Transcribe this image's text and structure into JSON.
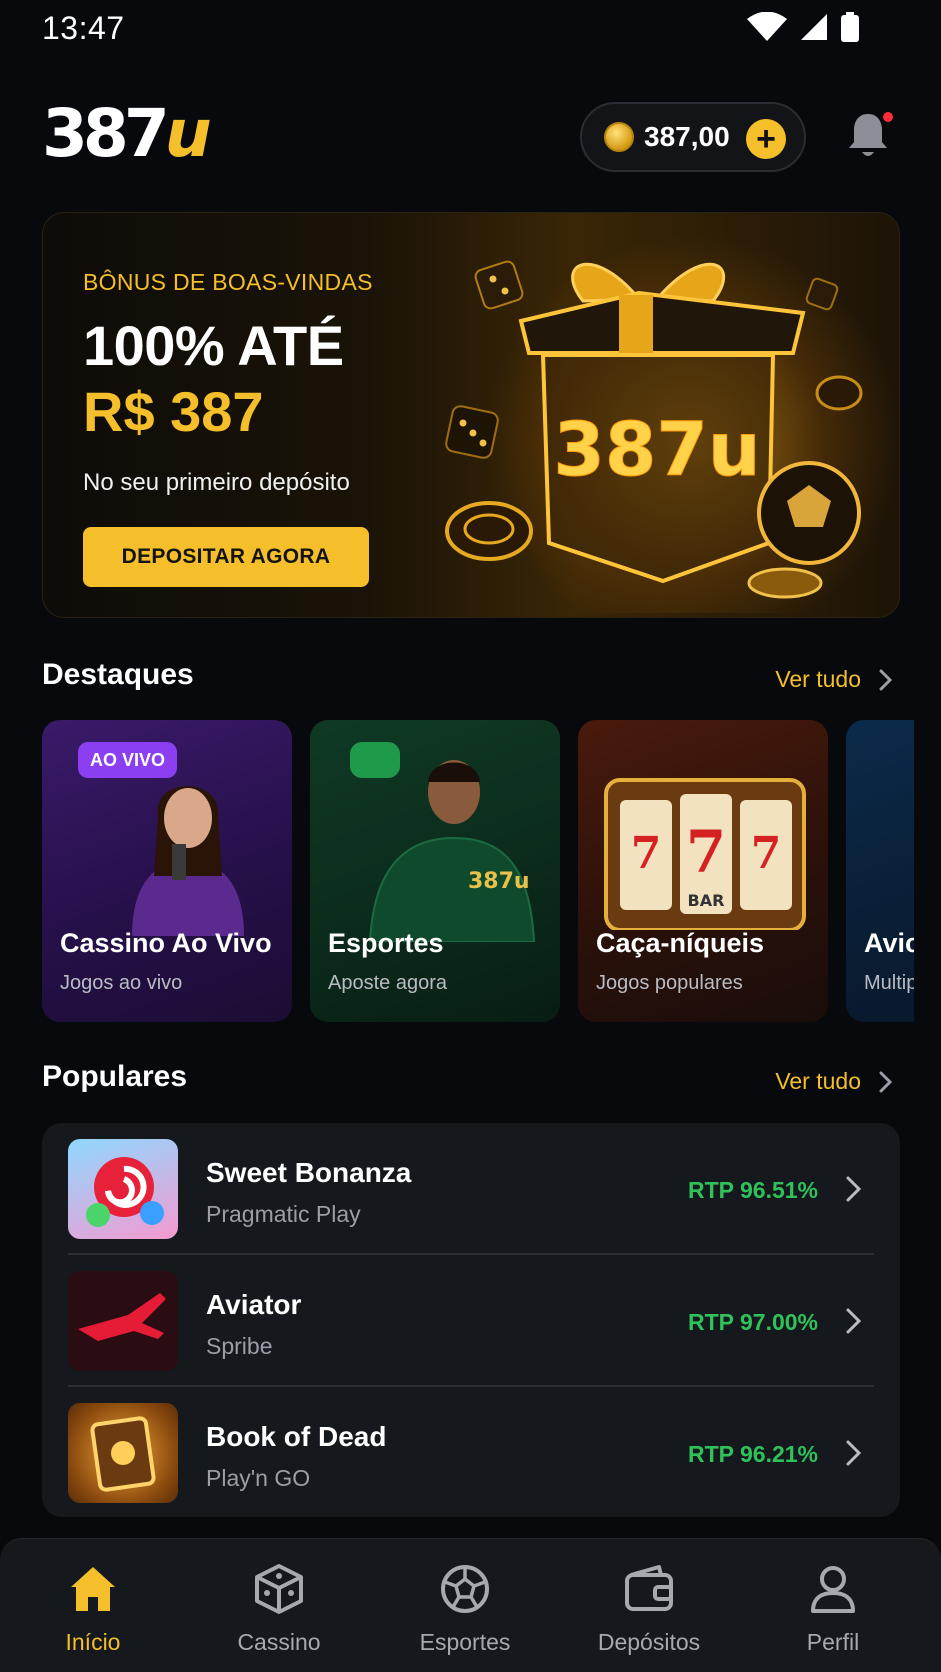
{
  "status_bar": {
    "time": "13:47"
  },
  "header": {
    "logo": {
      "number": "387",
      "suffix": "u"
    },
    "balance": "387,00",
    "add_symbol": "+"
  },
  "hero": {
    "eyebrow": "BÔNUS DE BOAS-VINDAS",
    "title": "100% ATÉ",
    "amount": "R$ 387",
    "subtitle": "No seu primeiro depósito",
    "cta_label": "DEPOSITAR AGORA",
    "box_label": "387u"
  },
  "featured": {
    "title": "Destaques",
    "see_all": "Ver tudo",
    "cards": [
      {
        "title": "Cassino Ao Vivo",
        "subtitle": "Jogos ao vivo",
        "badge": "AO VIVO"
      },
      {
        "title": "Esportes",
        "subtitle": "Aposte agora",
        "jersey_text": "387u"
      },
      {
        "title": "Caça-níqueis",
        "subtitle": "Jogos populares",
        "reel_text": "BAR"
      },
      {
        "title": "Avic",
        "subtitle": "Multip"
      }
    ]
  },
  "popular": {
    "title": "Populares",
    "see_all": "Ver tudo",
    "items": [
      {
        "name": "Sweet Bonanza",
        "provider": "Pragmatic Play",
        "rtp": "RTP 96.51%"
      },
      {
        "name": "Aviator",
        "provider": "Spribe",
        "rtp": "RTP 97.00%"
      },
      {
        "name": "Book of Dead",
        "provider": "Play'n GO",
        "rtp": "RTP 96.21%"
      }
    ]
  },
  "bottom_nav": {
    "active_index": 0,
    "items": [
      {
        "label": "Início",
        "icon": "home-icon"
      },
      {
        "label": "Cassino",
        "icon": "dice-icon"
      },
      {
        "label": "Esportes",
        "icon": "soccer-ball-icon"
      },
      {
        "label": "Depósitos",
        "icon": "wallet-icon"
      },
      {
        "label": "Perfil",
        "icon": "user-icon"
      }
    ]
  },
  "colors": {
    "accent": "#f4bf2a",
    "background": "#07090c",
    "rtp_green": "#2fc25b",
    "live_purple": "#8b3ff0"
  }
}
